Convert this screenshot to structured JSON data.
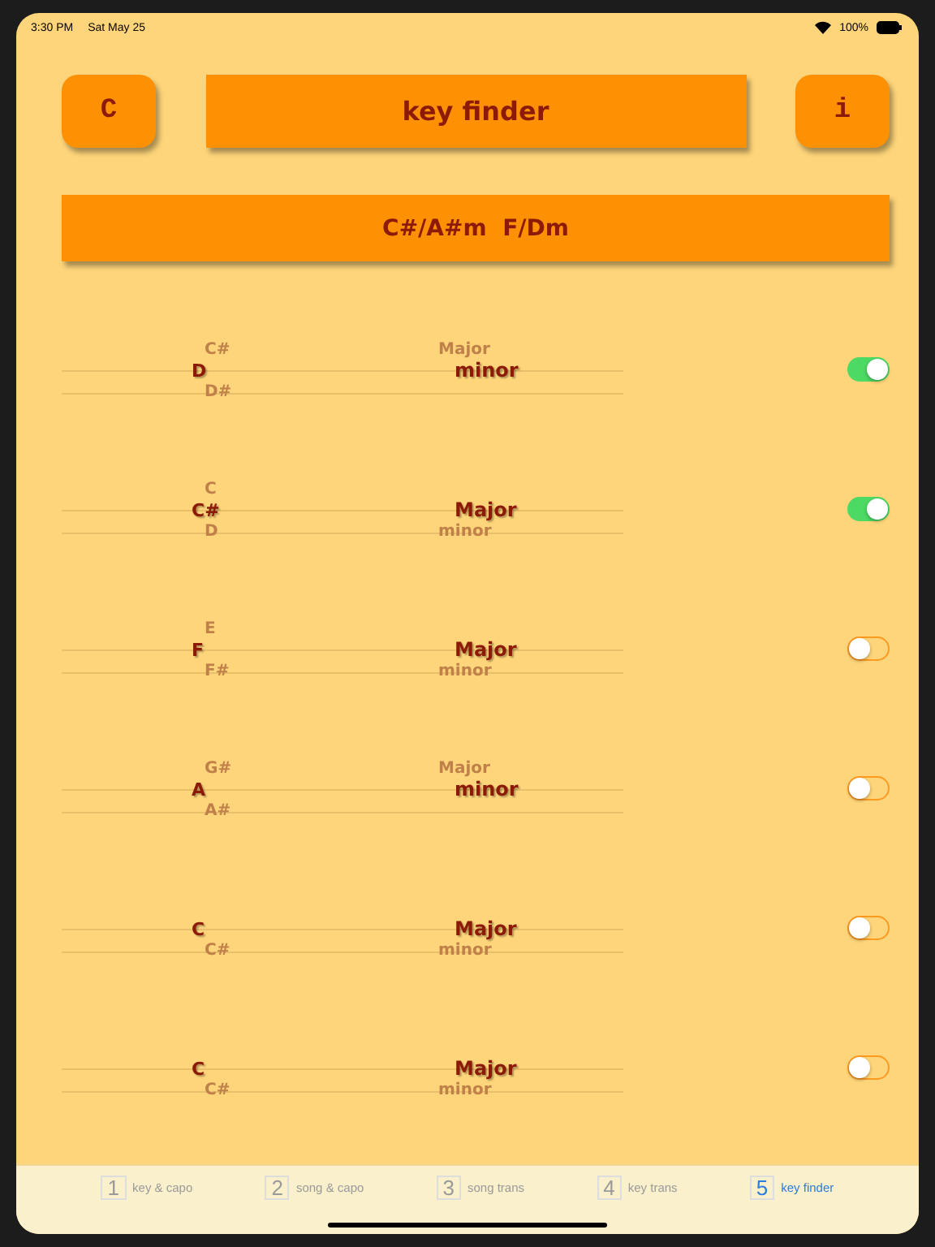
{
  "status_bar": {
    "time": "3:30 PM",
    "date": "Sat May 25",
    "battery": "100%"
  },
  "header": {
    "left_button": "C",
    "title": "key finder",
    "right_button": "i"
  },
  "result": "C#/A#m  F/Dm",
  "rows": [
    {
      "notes": [
        {
          "label": "C#",
          "selected": false
        },
        {
          "label": "D",
          "selected": true
        },
        {
          "label": "D#",
          "selected": false
        }
      ],
      "modes": [
        {
          "label": "Major",
          "selected": false
        },
        {
          "label": "minor",
          "selected": true
        }
      ],
      "on": true
    },
    {
      "notes": [
        {
          "label": "C",
          "selected": false
        },
        {
          "label": "C#",
          "selected": true
        },
        {
          "label": "D",
          "selected": false
        }
      ],
      "modes": [
        {
          "label": "Major",
          "selected": true
        },
        {
          "label": "minor",
          "selected": false
        }
      ],
      "on": true
    },
    {
      "notes": [
        {
          "label": "E",
          "selected": false
        },
        {
          "label": "F",
          "selected": true
        },
        {
          "label": "F#",
          "selected": false
        }
      ],
      "modes": [
        {
          "label": "Major",
          "selected": true
        },
        {
          "label": "minor",
          "selected": false
        }
      ],
      "on": false
    },
    {
      "notes": [
        {
          "label": "G#",
          "selected": false
        },
        {
          "label": "A",
          "selected": true
        },
        {
          "label": "A#",
          "selected": false
        }
      ],
      "modes": [
        {
          "label": "Major",
          "selected": false
        },
        {
          "label": "minor",
          "selected": true
        }
      ],
      "on": false
    },
    {
      "notes": [
        {
          "label": "C",
          "selected": true
        },
        {
          "label": "C#",
          "selected": false
        }
      ],
      "modes": [
        {
          "label": "Major",
          "selected": true
        },
        {
          "label": "minor",
          "selected": false
        }
      ],
      "on": false
    },
    {
      "notes": [
        {
          "label": "C",
          "selected": true
        },
        {
          "label": "C#",
          "selected": false
        }
      ],
      "modes": [
        {
          "label": "Major",
          "selected": true
        },
        {
          "label": "minor",
          "selected": false
        }
      ],
      "on": false
    }
  ],
  "tabs": [
    {
      "number": "1",
      "label": "key & capo",
      "selected": false
    },
    {
      "number": "2",
      "label": "song & capo",
      "selected": false
    },
    {
      "number": "3",
      "label": "song trans",
      "selected": false
    },
    {
      "number": "4",
      "label": "key trans",
      "selected": false
    },
    {
      "number": "5",
      "label": "key finder",
      "selected": true
    }
  ]
}
